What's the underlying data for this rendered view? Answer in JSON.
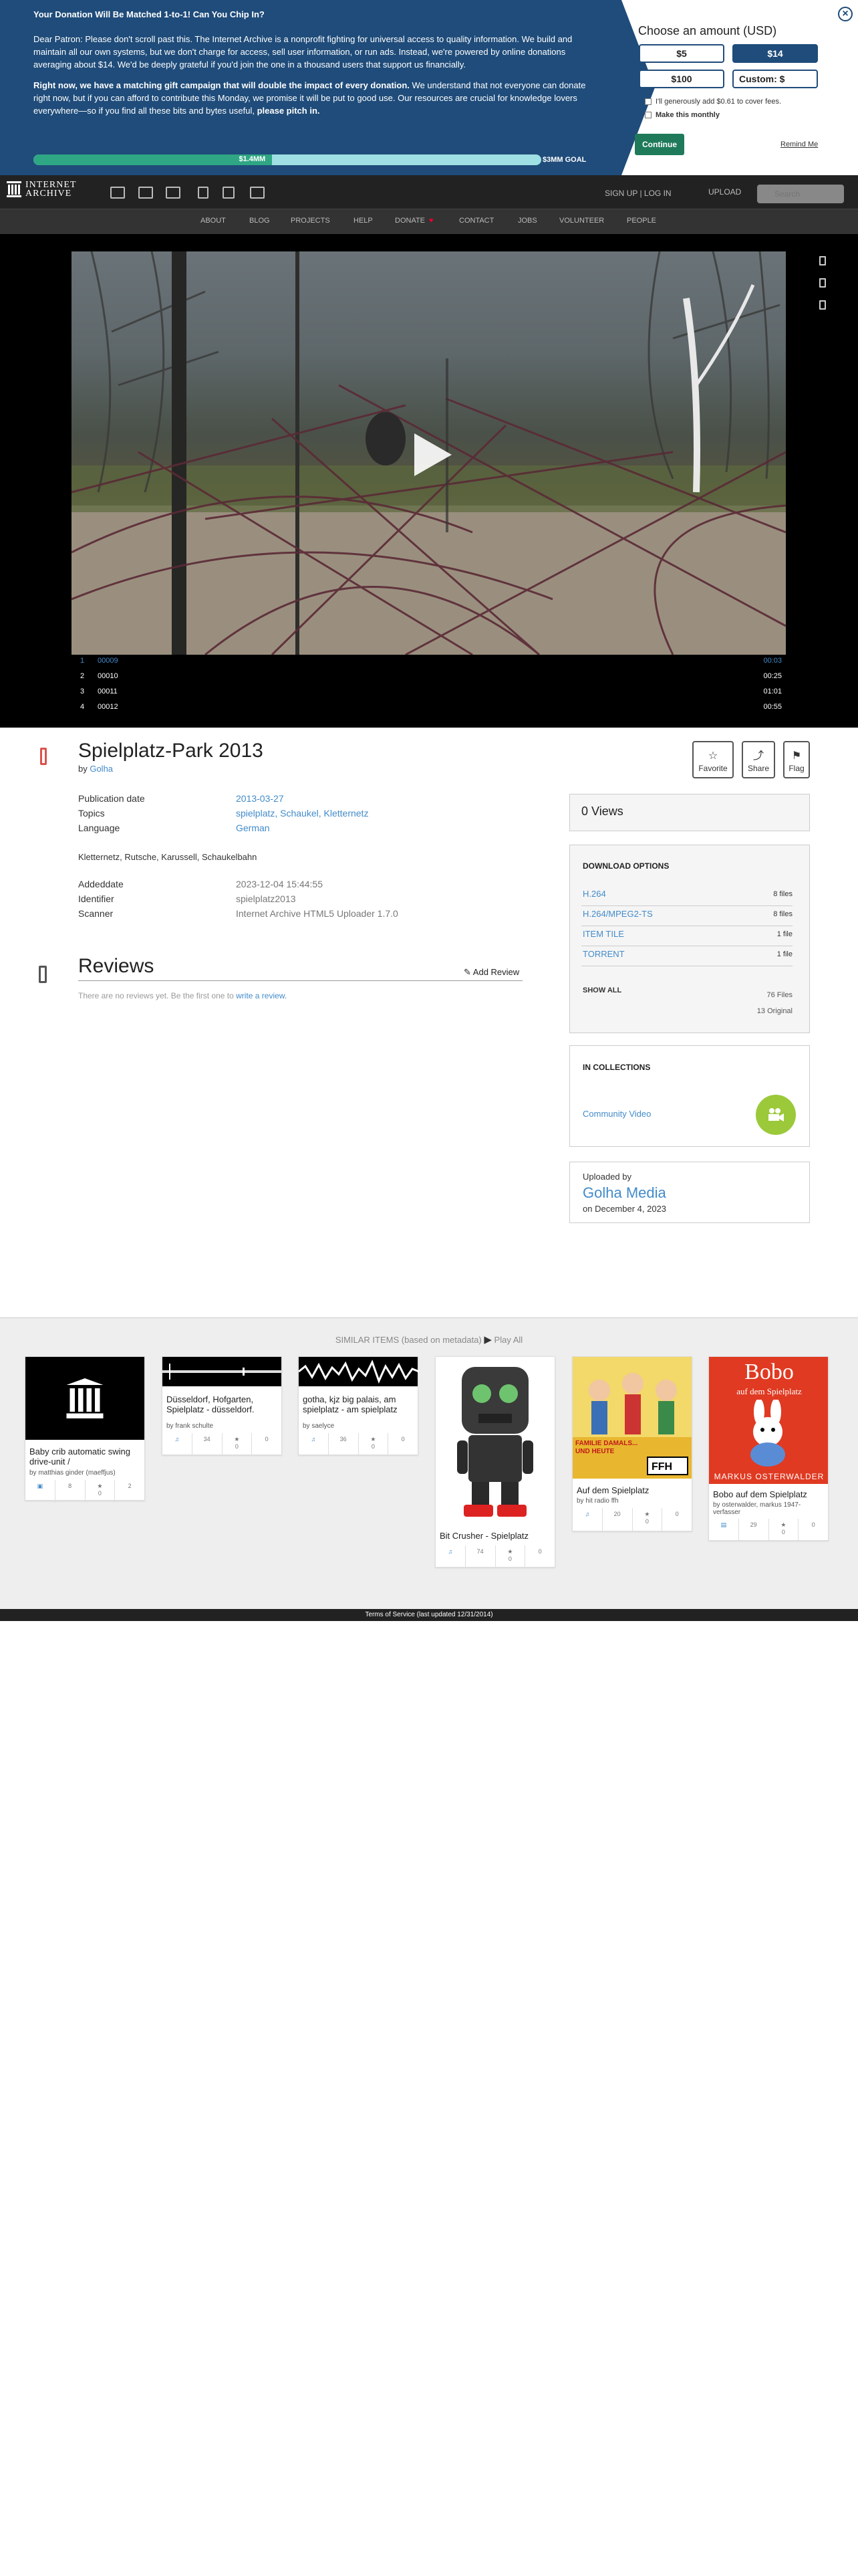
{
  "banner": {
    "title": "Your Donation Will Be Matched 1-to-1! Can You Chip In?",
    "p1": "Dear Patron: Please don't scroll past this. The Internet Archive is a nonprofit fighting for universal access to quality information. We build and maintain all our own systems, but we don't charge for access, sell user information, or run ads. Instead, we're powered by online donations averaging about $14. We'd be deeply grateful if you'd join the one in a thousand users that support us financially.",
    "p2_bold": "Right now, we have a matching gift campaign that will double the impact of every donation.",
    "p2": " We understand that not everyone can donate right now, but if you can afford to contribute this Monday, we promise it will be put to good use. Our resources are crucial for knowledge lovers everywhere—so if you find all these bits and bytes useful,",
    "p2_end": " please pitch in.",
    "raised": "$1.4MM",
    "goal": "$3MM GOAL",
    "progress_fraction": 0.47,
    "amount_title": "Choose an amount (USD)",
    "amounts": [
      "$5",
      "$14",
      "$100",
      "Custom: $"
    ],
    "selected_amount": "$14",
    "fee_label": "I'll generously add $0.61 to cover fees.",
    "monthly_label": "Make this monthly",
    "continue": "Continue",
    "remind": "Remind Me",
    "close": "×",
    "bg_color": "#1f4c7a"
  },
  "nav": {
    "logo_line1": "INTERNET",
    "logo_line2": "ARCHIVE",
    "signup": "SIGN UP | LOG IN",
    "upload": "UPLOAD",
    "search_placeholder": "Search",
    "menu": [
      "ABOUT",
      "BLOG",
      "PROJECTS",
      "HELP",
      "DONATE",
      "CONTACT",
      "JOBS",
      "VOLUNTEER",
      "PEOPLE"
    ]
  },
  "player": {
    "tracks": [
      {
        "num": "1",
        "name": "00009",
        "dur": "00:03",
        "active": true
      },
      {
        "num": "2",
        "name": "00010",
        "dur": "00:25",
        "active": false
      },
      {
        "num": "3",
        "name": "00011",
        "dur": "01:01",
        "active": false
      },
      {
        "num": "4",
        "name": "00012",
        "dur": "00:55",
        "active": false
      }
    ]
  },
  "item": {
    "title": "Spielplatz-Park  2013",
    "by_label": "by ",
    "creator": "Golha",
    "actions": [
      "Favorite",
      "Share",
      "Flag"
    ],
    "metadata": [
      {
        "key": "Publication date",
        "value": "2013-03-27",
        "link": true
      },
      {
        "key": "Topics",
        "value": "spielplatz, Schaukel, Kletternetz",
        "link": true
      },
      {
        "key": "Language",
        "value": "German",
        "link": true
      }
    ],
    "description": "Kletternetz, Rutsche, Karussell, Schaukelbahn",
    "metadata2": [
      {
        "key": "Addeddate",
        "value": "2023-12-04 15:44:55"
      },
      {
        "key": "Identifier",
        "value": "spielplatz2013"
      },
      {
        "key": "Scanner",
        "value": "Internet Archive HTML5 Uploader 1.7.0"
      }
    ]
  },
  "reviews": {
    "title": "Reviews",
    "add": "Add Review",
    "empty": "There are no reviews yet. Be the first one to ",
    "empty_link": "write a review."
  },
  "sidebar": {
    "views": "0 Views",
    "download_title": "DOWNLOAD OPTIONS",
    "downloads": [
      {
        "name": "H.264",
        "count": "8 files"
      },
      {
        "name": "H.264/MPEG2-TS",
        "count": "8 files"
      },
      {
        "name": "ITEM TILE",
        "count": "1 file"
      },
      {
        "name": "TORRENT",
        "count": "1 file"
      }
    ],
    "show_all": "SHOW ALL",
    "files_total": "76 Files",
    "files_original": "13 Original",
    "collections_title": "IN COLLECTIONS",
    "collection": "Community Video",
    "uploaded_by_label": "Uploaded by",
    "uploader": "Golha Media",
    "upload_date": "on December 4, 2023"
  },
  "similar": {
    "title": "SIMILAR ITEMS (based on metadata)",
    "play_all": "Play All",
    "items": [
      {
        "title": "Baby crib automatic swing drive-unit /",
        "by": "by matthias ginder (maeffjus)",
        "stats": [
          "3",
          "8",
          "0",
          "2"
        ]
      },
      {
        "title": "Düsseldorf, Hofgarten, Spielplatz - düsseldorf.",
        "by": "by frank schulte",
        "stats": [
          "3",
          "34",
          "0",
          "0"
        ]
      },
      {
        "title": "gotha, kjz big palais, am spielplatz - am spielplatz",
        "by": "by saelyce",
        "stats": [
          "3",
          "36",
          "0",
          "0"
        ]
      },
      {
        "title": "Bit Crusher - Spielplatz",
        "by": "",
        "stats": [
          "3",
          "74",
          "0",
          "0"
        ]
      },
      {
        "title": "Auf dem Spielplatz",
        "by": "by hit radio ffh",
        "stats": [
          "3",
          "20",
          "0",
          "0"
        ]
      },
      {
        "title": "Bobo auf dem Spielplatz",
        "by": "by osterwalder, markus 1947- verfasser",
        "stats": [
          "3",
          "29",
          "0",
          "0"
        ]
      }
    ],
    "bobo_cover_title": "Bobo",
    "bobo_cover_sub": "auf dem Spielplatz",
    "bobo_cover_author": "MARKUS OSTERWALDER",
    "ffh_cover_text": "FAMILIE DAMALS... UND HEUTE"
  },
  "footer": "Terms of Service (last updated 12/31/2014)"
}
